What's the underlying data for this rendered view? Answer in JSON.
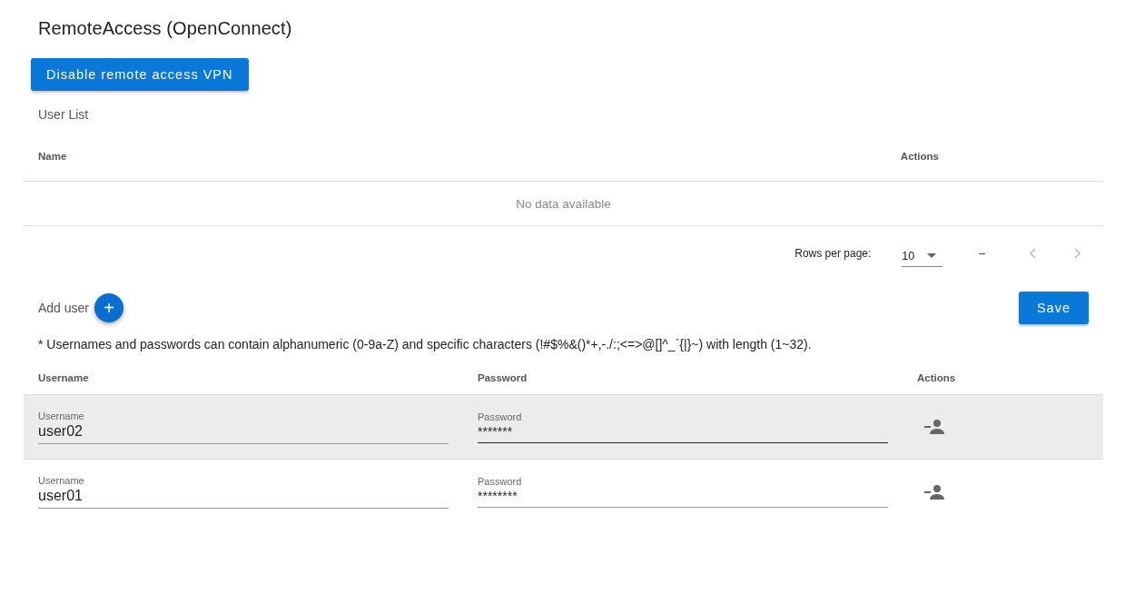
{
  "title": "RemoteAccess (OpenConnect)",
  "toggle_button": "Disable remote access VPN",
  "user_list": {
    "label": "User List",
    "columns": [
      "Name",
      "Actions"
    ],
    "empty_text": "No data available",
    "pagination": {
      "rows_per_page_label": "Rows per page:",
      "rows_per_page": "10",
      "range": "–"
    }
  },
  "add_user": {
    "label": "Add user",
    "button": "+"
  },
  "save_button": "Save",
  "note": "* Usernames and passwords can contain alphanumeric (0-9a-Z) and specific characters (!#$%&()*+,-./:;<=>@[]^_`{|}~) with length (1~32).",
  "users": {
    "columns": [
      "Username",
      "Password",
      "Actions"
    ],
    "rows": [
      {
        "username_label": "Username",
        "username": "user02",
        "password_label": "Password",
        "password": "*******",
        "hovered": true
      },
      {
        "username_label": "Username",
        "username": "user01",
        "password_label": "Password",
        "password": "********",
        "hovered": false
      }
    ]
  }
}
